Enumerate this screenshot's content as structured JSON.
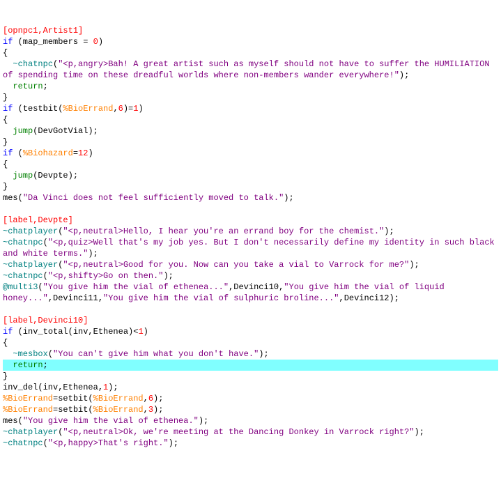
{
  "lines": [
    {
      "parts": [
        {
          "c": "red",
          "t": "[opnpc1,Artist1]"
        }
      ]
    },
    {
      "parts": [
        {
          "c": "blue",
          "t": "if"
        },
        {
          "c": "black",
          "t": " (map_members "
        },
        {
          "c": "black",
          "t": "="
        },
        {
          "c": "black",
          "t": " "
        },
        {
          "c": "red",
          "t": "0"
        },
        {
          "c": "black",
          "t": ")"
        }
      ]
    },
    {
      "parts": [
        {
          "c": "black",
          "t": "{"
        }
      ]
    },
    {
      "parts": [
        {
          "c": "black",
          "t": "  "
        },
        {
          "c": "teal",
          "t": "~chatnpc"
        },
        {
          "c": "black",
          "t": "("
        },
        {
          "c": "purple",
          "t": "\"<p,angry>Bah! A great artist such as myself should not have to suffer the HUMILIATION of spending time on these dreadful worlds where non-members wander everywhere!\""
        },
        {
          "c": "black",
          "t": ");"
        }
      ]
    },
    {
      "parts": [
        {
          "c": "black",
          "t": "  "
        },
        {
          "c": "green",
          "t": "return"
        },
        {
          "c": "black",
          "t": ";"
        }
      ]
    },
    {
      "parts": [
        {
          "c": "black",
          "t": "}"
        }
      ]
    },
    {
      "parts": [
        {
          "c": "blue",
          "t": "if"
        },
        {
          "c": "black",
          "t": " (testbit("
        },
        {
          "c": "orange",
          "t": "%BioErrand"
        },
        {
          "c": "black",
          "t": ","
        },
        {
          "c": "red",
          "t": "6"
        },
        {
          "c": "black",
          "t": ")"
        },
        {
          "c": "black",
          "t": "="
        },
        {
          "c": "red",
          "t": "1"
        },
        {
          "c": "black",
          "t": ")"
        }
      ]
    },
    {
      "parts": [
        {
          "c": "black",
          "t": "{"
        }
      ]
    },
    {
      "parts": [
        {
          "c": "black",
          "t": "  "
        },
        {
          "c": "green",
          "t": "jump"
        },
        {
          "c": "black",
          "t": "(DevGotVial);"
        }
      ]
    },
    {
      "parts": [
        {
          "c": "black",
          "t": "}"
        }
      ]
    },
    {
      "parts": [
        {
          "c": "blue",
          "t": "if"
        },
        {
          "c": "black",
          "t": " ("
        },
        {
          "c": "orange",
          "t": "%Biohazard"
        },
        {
          "c": "black",
          "t": "="
        },
        {
          "c": "red",
          "t": "12"
        },
        {
          "c": "black",
          "t": ")"
        }
      ]
    },
    {
      "parts": [
        {
          "c": "black",
          "t": "{"
        }
      ]
    },
    {
      "parts": [
        {
          "c": "black",
          "t": "  "
        },
        {
          "c": "green",
          "t": "jump"
        },
        {
          "c": "black",
          "t": "(Devpte);"
        }
      ]
    },
    {
      "parts": [
        {
          "c": "black",
          "t": "}"
        }
      ]
    },
    {
      "parts": [
        {
          "c": "black",
          "t": "mes("
        },
        {
          "c": "purple",
          "t": "\"Da Vinci does not feel sufficiently moved to talk.\""
        },
        {
          "c": "black",
          "t": ");"
        }
      ]
    },
    {
      "parts": [
        {
          "c": "black",
          "t": ""
        }
      ]
    },
    {
      "parts": [
        {
          "c": "red",
          "t": "[label,Devpte]"
        }
      ]
    },
    {
      "parts": [
        {
          "c": "teal",
          "t": "~chatplayer"
        },
        {
          "c": "black",
          "t": "("
        },
        {
          "c": "purple",
          "t": "\"<p,neutral>Hello, I hear you're an errand boy for the chemist.\""
        },
        {
          "c": "black",
          "t": ");"
        }
      ]
    },
    {
      "parts": [
        {
          "c": "teal",
          "t": "~chatnpc"
        },
        {
          "c": "black",
          "t": "("
        },
        {
          "c": "purple",
          "t": "\"<p,quiz>Well that's my job yes. But I don't necessarily define my identity in such black and white terms.\""
        },
        {
          "c": "black",
          "t": ");"
        }
      ]
    },
    {
      "parts": [
        {
          "c": "teal",
          "t": "~chatplayer"
        },
        {
          "c": "black",
          "t": "("
        },
        {
          "c": "purple",
          "t": "\"<p,neutral>Good for you. Now can you take a vial to Varrock for me?\""
        },
        {
          "c": "black",
          "t": ");"
        }
      ]
    },
    {
      "parts": [
        {
          "c": "teal",
          "t": "~chatnpc"
        },
        {
          "c": "black",
          "t": "("
        },
        {
          "c": "purple",
          "t": "\"<p,shifty>Go on then.\""
        },
        {
          "c": "black",
          "t": ");"
        }
      ]
    },
    {
      "parts": [
        {
          "c": "teal",
          "t": "@multi3"
        },
        {
          "c": "black",
          "t": "("
        },
        {
          "c": "purple",
          "t": "\"You give him the vial of ethenea...\""
        },
        {
          "c": "black",
          "t": ",Devinci10,"
        },
        {
          "c": "purple",
          "t": "\"You give him the vial of liquid honey...\""
        },
        {
          "c": "black",
          "t": ",Devinci11,"
        },
        {
          "c": "purple",
          "t": "\"You give him the vial of sulphuric broline...\""
        },
        {
          "c": "black",
          "t": ",Devinci12);"
        }
      ]
    },
    {
      "parts": [
        {
          "c": "black",
          "t": ""
        }
      ]
    },
    {
      "parts": [
        {
          "c": "red",
          "t": "[label,Devinci10]"
        }
      ]
    },
    {
      "parts": [
        {
          "c": "blue",
          "t": "if"
        },
        {
          "c": "black",
          "t": " (inv_total(inv,Ethenea)<"
        },
        {
          "c": "red",
          "t": "1"
        },
        {
          "c": "black",
          "t": ")"
        }
      ]
    },
    {
      "parts": [
        {
          "c": "black",
          "t": "{"
        }
      ]
    },
    {
      "parts": [
        {
          "c": "black",
          "t": "  "
        },
        {
          "c": "teal",
          "t": "~mesbox"
        },
        {
          "c": "black",
          "t": "("
        },
        {
          "c": "purple",
          "t": "\"You can't give him what you don't have.\""
        },
        {
          "c": "black",
          "t": ");"
        }
      ]
    },
    {
      "hl": true,
      "parts": [
        {
          "c": "black",
          "t": "  "
        },
        {
          "c": "green",
          "t": "return"
        },
        {
          "c": "black",
          "t": ";"
        }
      ]
    },
    {
      "parts": [
        {
          "c": "black",
          "t": "}"
        }
      ]
    },
    {
      "parts": [
        {
          "c": "black",
          "t": "inv_del(inv,Ethenea,"
        },
        {
          "c": "red",
          "t": "1"
        },
        {
          "c": "black",
          "t": ");"
        }
      ]
    },
    {
      "parts": [
        {
          "c": "orange",
          "t": "%BioErrand"
        },
        {
          "c": "black",
          "t": "=setbit("
        },
        {
          "c": "orange",
          "t": "%BioErrand"
        },
        {
          "c": "black",
          "t": ","
        },
        {
          "c": "red",
          "t": "6"
        },
        {
          "c": "black",
          "t": ");"
        }
      ]
    },
    {
      "parts": [
        {
          "c": "orange",
          "t": "%BioErrand"
        },
        {
          "c": "black",
          "t": "=setbit("
        },
        {
          "c": "orange",
          "t": "%BioErrand"
        },
        {
          "c": "black",
          "t": ","
        },
        {
          "c": "red",
          "t": "3"
        },
        {
          "c": "black",
          "t": ");"
        }
      ]
    },
    {
      "parts": [
        {
          "c": "black",
          "t": "mes("
        },
        {
          "c": "purple",
          "t": "\"You give him the vial of ethenea.\""
        },
        {
          "c": "black",
          "t": ");"
        }
      ]
    },
    {
      "parts": [
        {
          "c": "teal",
          "t": "~chatplayer"
        },
        {
          "c": "black",
          "t": "("
        },
        {
          "c": "purple",
          "t": "\"<p,neutral>Ok, we're meeting at the Dancing Donkey in Varrock right?\""
        },
        {
          "c": "black",
          "t": ");"
        }
      ]
    },
    {
      "parts": [
        {
          "c": "teal",
          "t": "~chatnpc"
        },
        {
          "c": "black",
          "t": "("
        },
        {
          "c": "purple",
          "t": "\"<p,happy>That's right.\""
        },
        {
          "c": "black",
          "t": ");"
        }
      ]
    }
  ]
}
